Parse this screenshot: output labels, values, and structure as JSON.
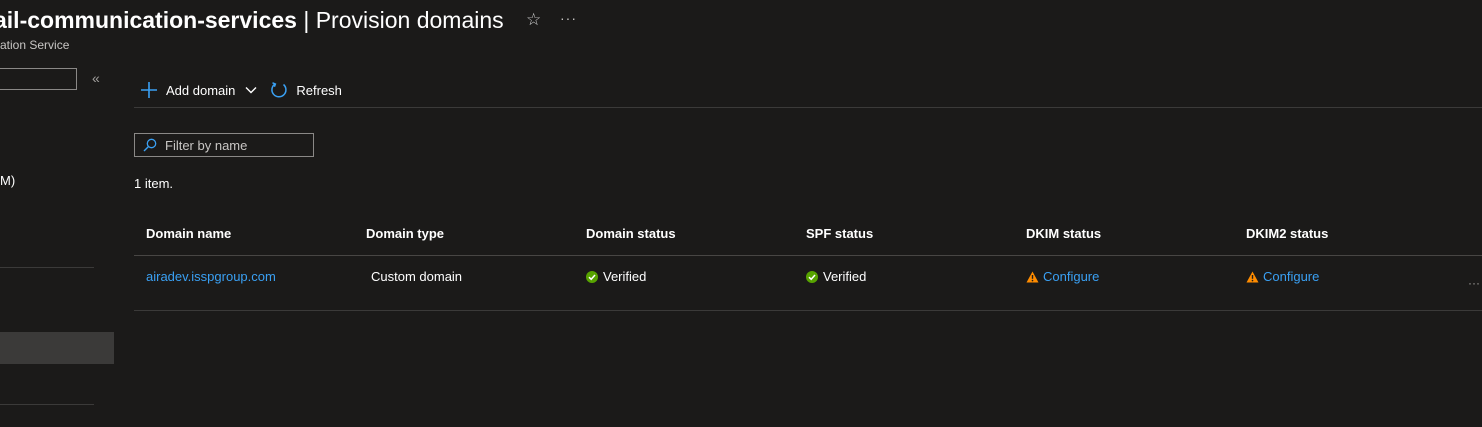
{
  "header": {
    "resource_name": "ail-communication-services",
    "separator": " | ",
    "page_title": "Provision domains",
    "subtitle": "ation Service"
  },
  "nav": {
    "partial_item": "M)"
  },
  "toolbar": {
    "add_domain_label": "Add domain",
    "refresh_label": "Refresh"
  },
  "filter": {
    "placeholder": "Filter by name",
    "value": ""
  },
  "item_count": "1 item.",
  "table": {
    "columns": [
      "Domain name",
      "Domain type",
      "Domain status",
      "SPF status",
      "DKIM status",
      "DKIM2 status"
    ],
    "rows": [
      {
        "domain_name": "airadev.isspgroup.com",
        "domain_type": "Custom domain",
        "domain_status": "Verified",
        "spf_status": "Verified",
        "dkim_status": "Configure",
        "dkim2_status": "Configure"
      }
    ]
  },
  "colors": {
    "background": "#1b1a19",
    "accent": "#3aa0f3",
    "success": "#57a300",
    "warning": "#ff8c00"
  }
}
